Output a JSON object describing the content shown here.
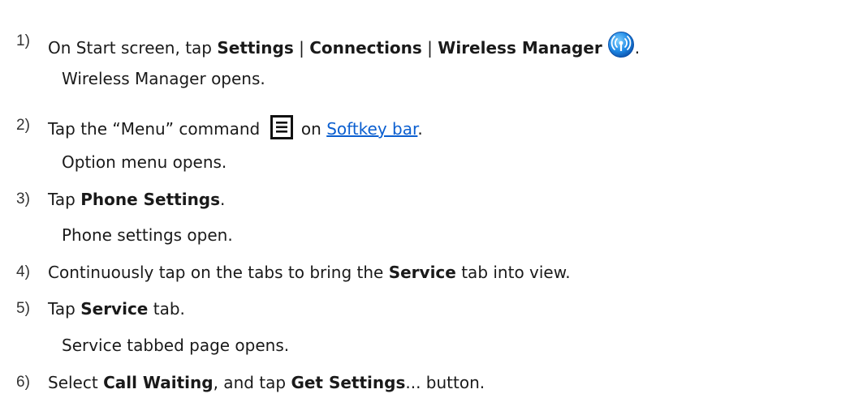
{
  "steps": [
    {
      "number": "1)",
      "parts": [
        "On Start screen, tap ",
        "Settings",
        " | ",
        "Connections",
        " | ",
        "Wireless Manager",
        "."
      ],
      "icon": "wireless-manager-icon",
      "result": "Wireless Manager opens."
    },
    {
      "number": "2)",
      "parts": [
        "Tap the “Menu” command ",
        " on ",
        "Softkey bar",
        "."
      ],
      "icon": "menu-command-icon",
      "result": "Option menu opens."
    },
    {
      "number": "3)",
      "parts": [
        "Tap ",
        "Phone Settings",
        "."
      ],
      "result": "Phone settings open."
    },
    {
      "number": "4)",
      "parts": [
        "Continuously tap on the tabs to bring the ",
        "Service",
        " tab into view."
      ]
    },
    {
      "number": "5)",
      "parts": [
        "Tap ",
        "Service",
        " tab."
      ],
      "result": "Service tabbed page opens."
    },
    {
      "number": "6)",
      "parts": [
        "Select ",
        "Call Waiting",
        ", and tap ",
        "Get Settings",
        "... button."
      ]
    }
  ],
  "colors": {
    "text": "#1a1a1a",
    "link": "#0b5fd0",
    "icon_blue": "#1e88e5"
  }
}
